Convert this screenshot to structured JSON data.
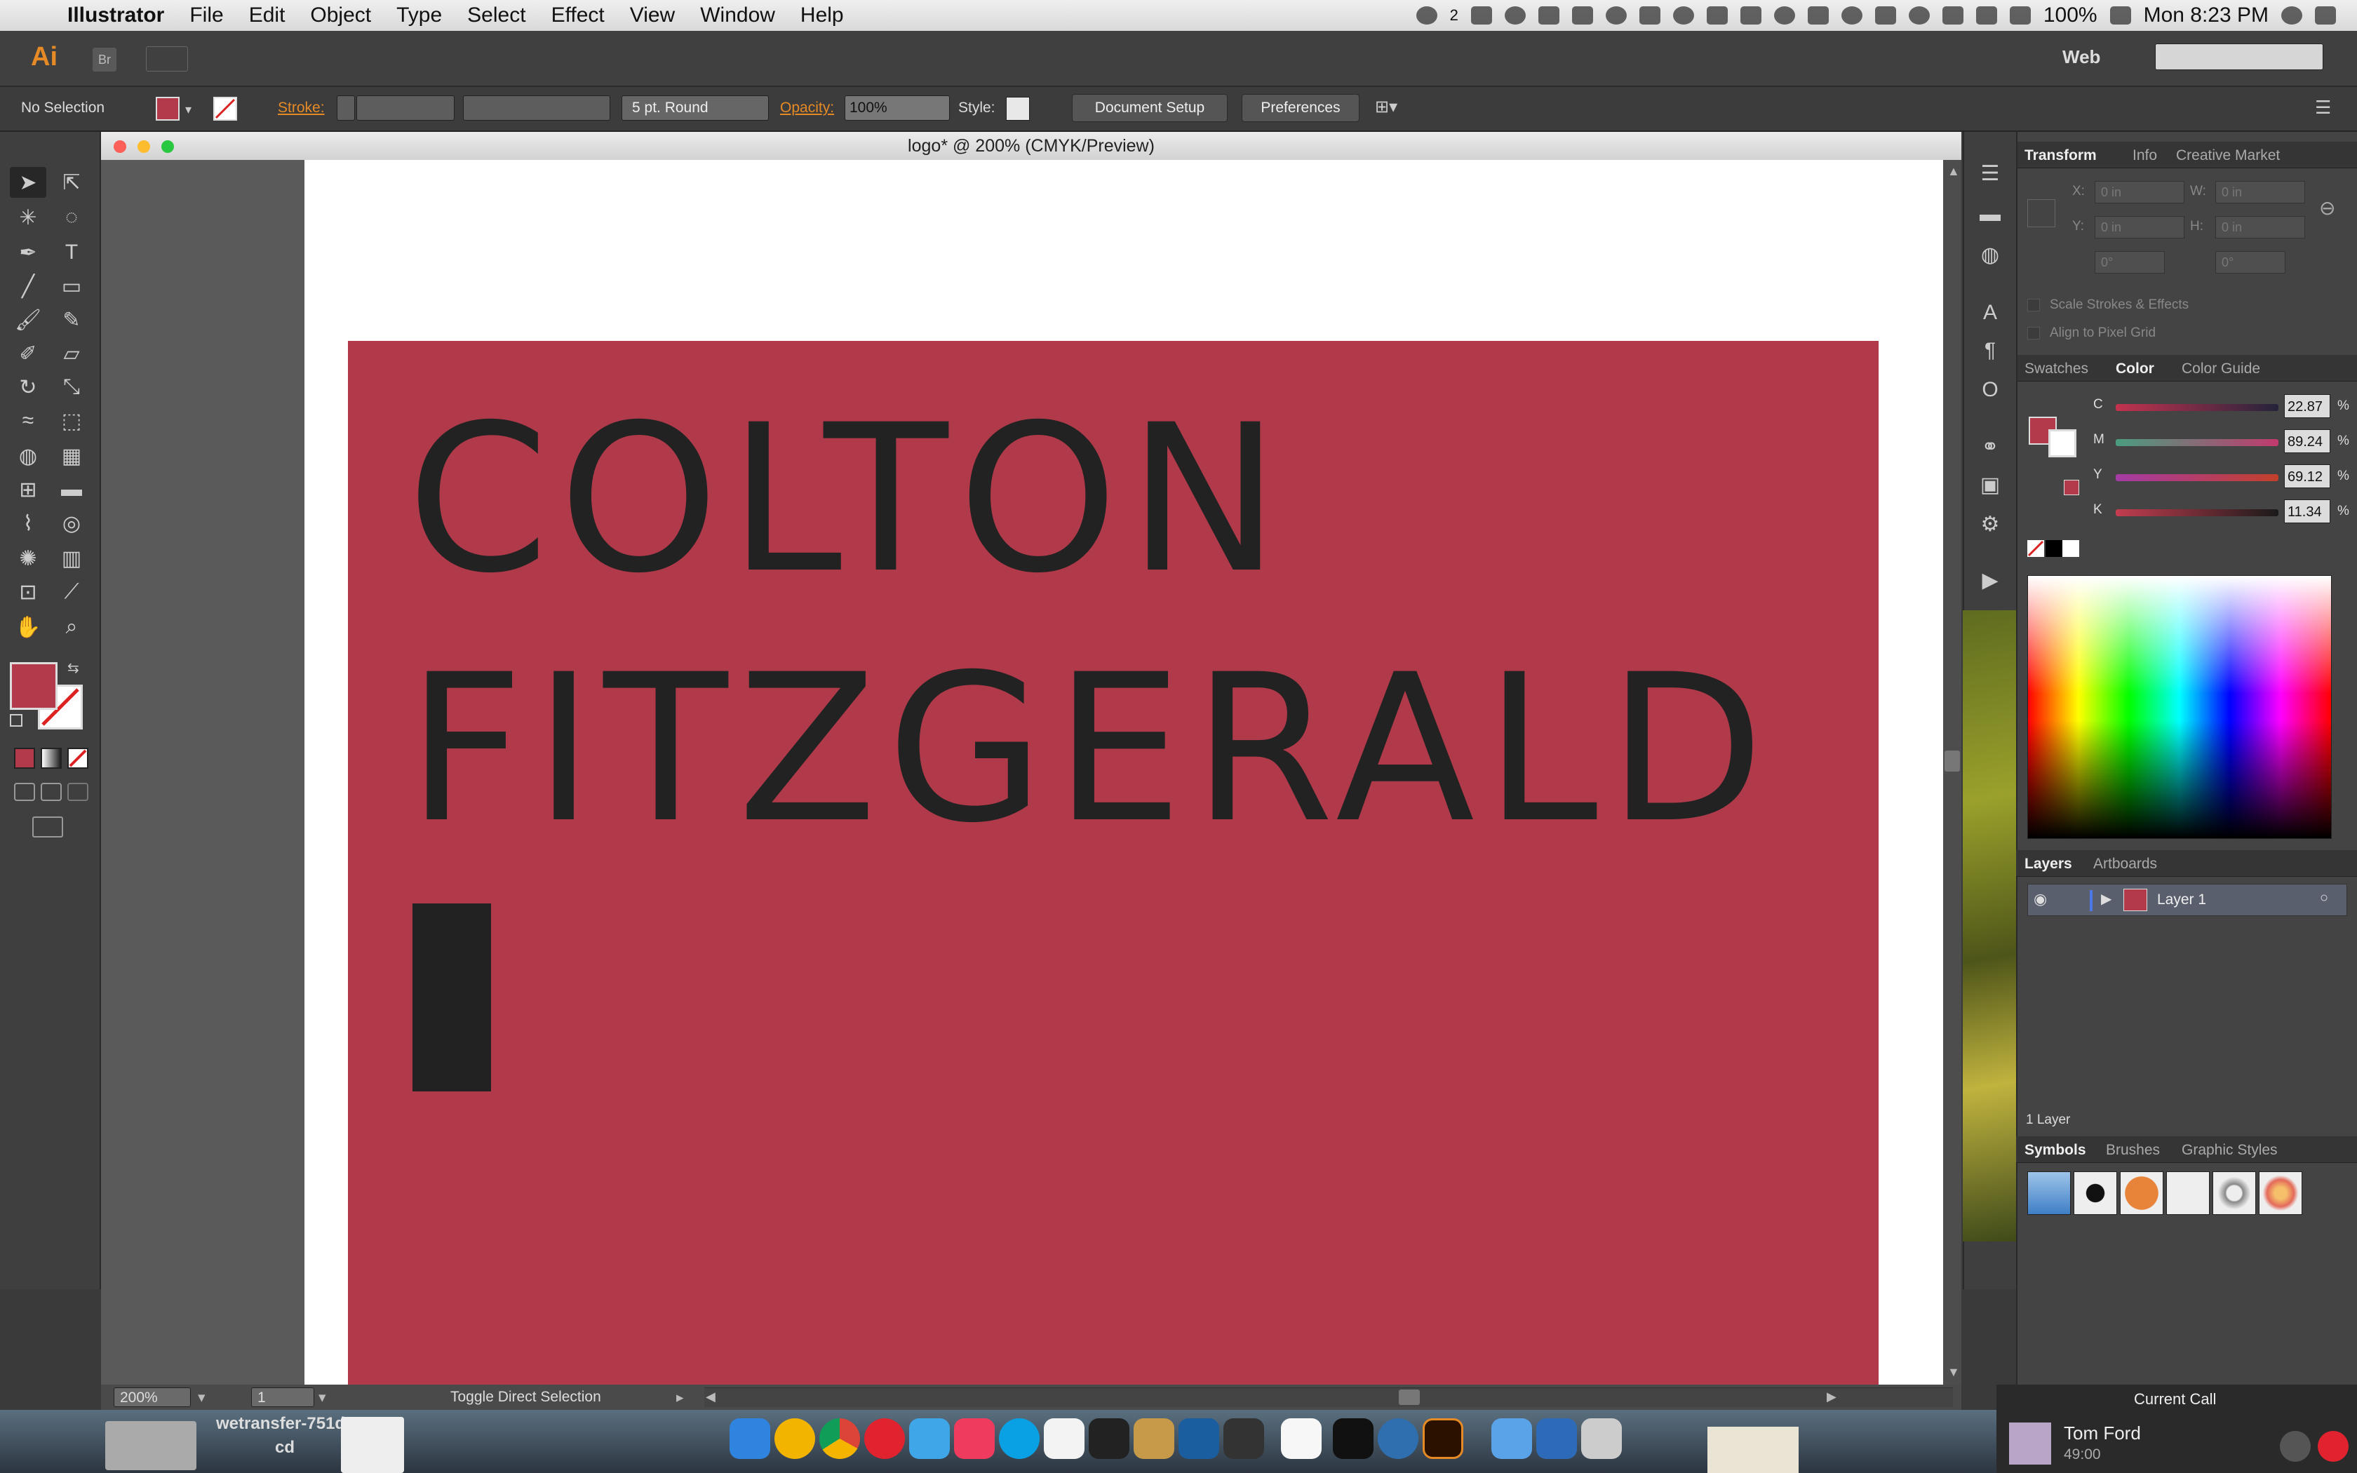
{
  "menubar": {
    "app_name": "Illustrator",
    "items": [
      "File",
      "Edit",
      "Object",
      "Type",
      "Select",
      "Effect",
      "View",
      "Window",
      "Help"
    ],
    "cc_badge": "2",
    "battery": "100%",
    "clock": "Mon 8:23 PM"
  },
  "appbar": {
    "logo": "Ai",
    "bridge": "Br",
    "workspace": "Web"
  },
  "control": {
    "selection": "No Selection",
    "stroke_label": "Stroke:",
    "brush": "5 pt. Round",
    "opacity_label": "Opacity:",
    "opacity": "100%",
    "style_label": "Style:",
    "doc_setup": "Document Setup",
    "preferences": "Preferences"
  },
  "document": {
    "title": "logo* @ 200% (CMYK/Preview)",
    "line1": "COLTON",
    "line2": "FITZGERALD",
    "zoom": "200%",
    "page": "1",
    "status": "Toggle Direct Selection"
  },
  "panels": {
    "transform_tabs": [
      "Transform",
      "Info",
      "Creative Market"
    ],
    "x_label": "X:",
    "y_label": "Y:",
    "w_label": "W:",
    "h_label": "H:",
    "x_val": "0 in",
    "y_val": "0 in",
    "w_val": "0 in",
    "h_val": "0 in",
    "angle1": "0°",
    "angle2": "0°",
    "scale_strokes": "Scale Strokes & Effects",
    "align_pixel": "Align to Pixel Grid",
    "color_tabs": [
      "Swatches",
      "Color",
      "Color Guide"
    ],
    "c_label": "C",
    "m_label": "M",
    "y2_label": "Y",
    "k_label": "K",
    "c_val": "22.87",
    "m_val": "89.24",
    "y_val2": "69.12",
    "k_val": "11.34",
    "pct": "%",
    "layer_tabs": [
      "Layers",
      "Artboards"
    ],
    "layer_name": "Layer 1",
    "layer_count": "1 Layer",
    "symbol_tabs": [
      "Symbols",
      "Brushes",
      "Graphic Styles"
    ]
  },
  "dock": {
    "file1": "wetransfer-751d",
    "file1b": "cd",
    "call_title": "Current Call",
    "caller": "Tom Ford",
    "call_time": "49:00"
  },
  "colors": {
    "artwork_fill": "#b13a4a",
    "text_color": "#222222",
    "accent_orange": "#e68a26"
  }
}
